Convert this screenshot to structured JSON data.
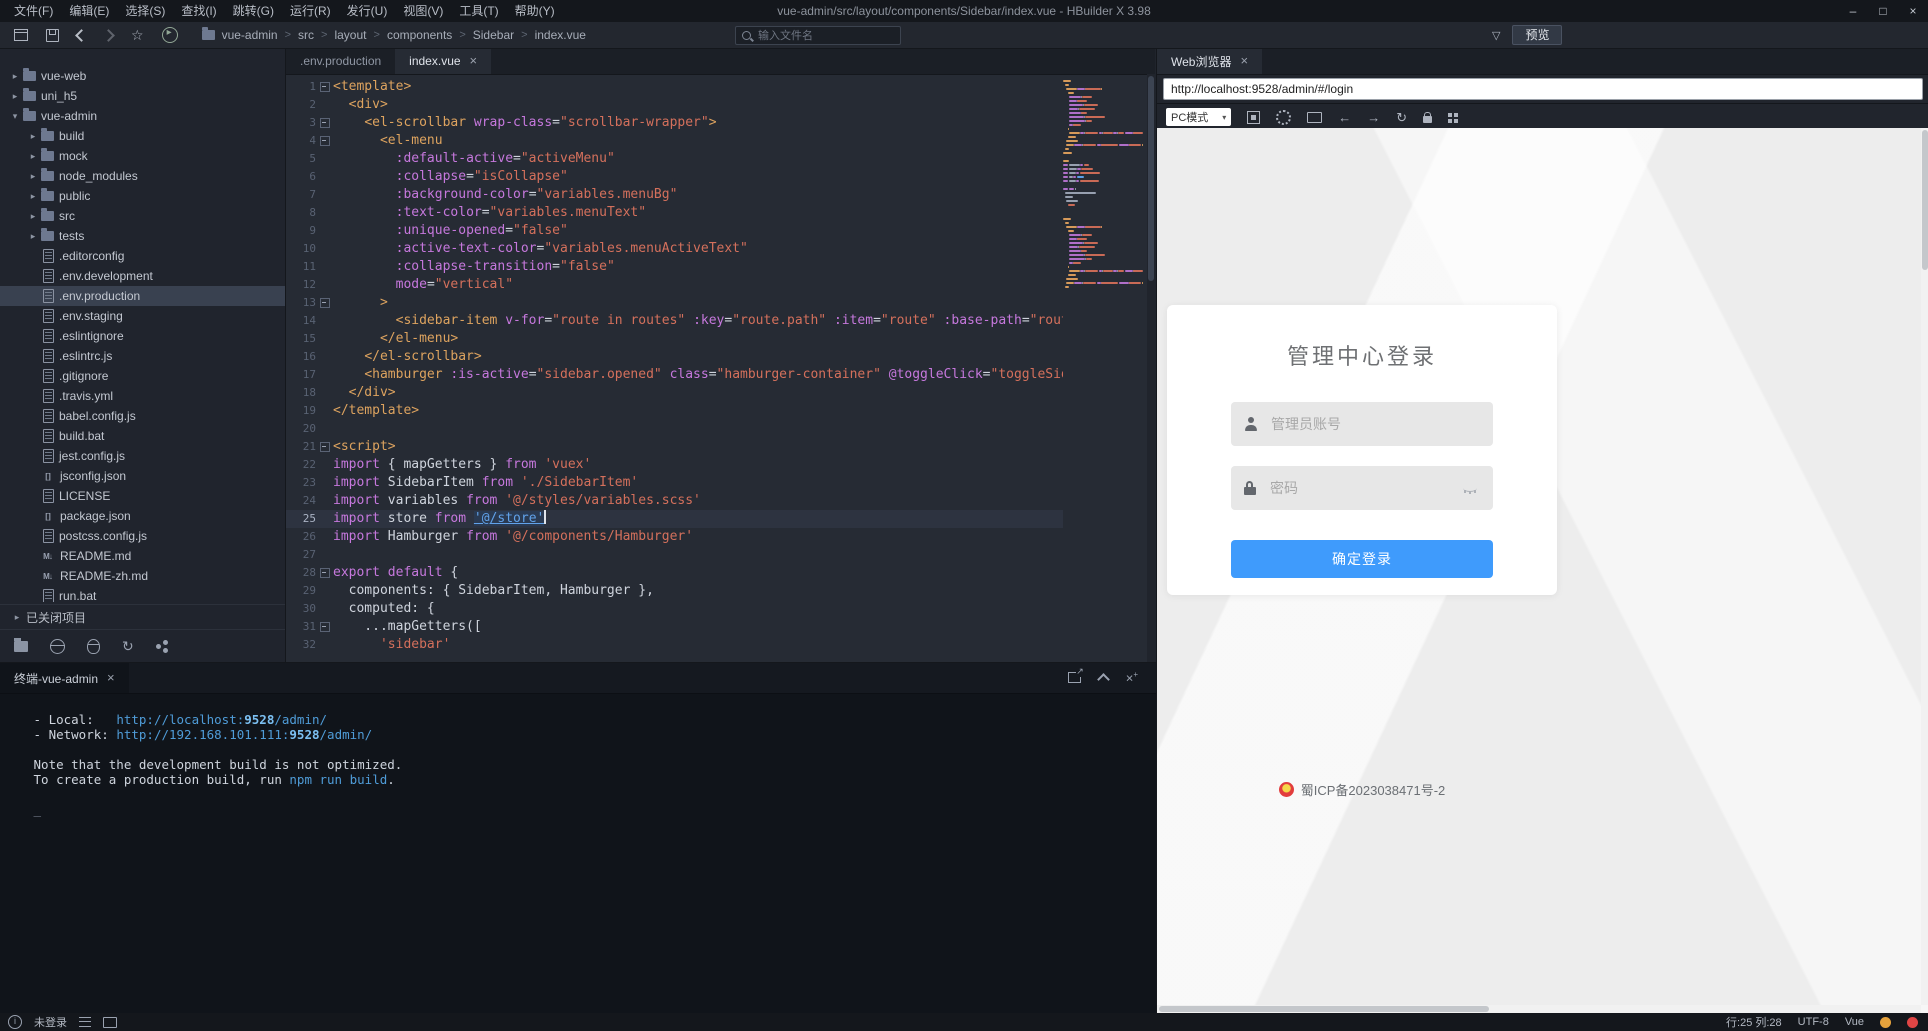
{
  "window": {
    "title": "vue-admin/src/layout/components/Sidebar/index.vue - HBuilder X 3.98",
    "menus": [
      "文件(F)",
      "编辑(E)",
      "选择(S)",
      "查找(I)",
      "跳转(G)",
      "运行(R)",
      "发行(U)",
      "视图(V)",
      "工具(T)",
      "帮助(Y)"
    ]
  },
  "icons": {
    "minimize": "–",
    "maximize": "□",
    "close": "×",
    "tab_close": "×",
    "chevron_right": "▸",
    "chevron_down": "▾",
    "breadcrumb_sep": ">",
    "dropdown": "▾",
    "back_arrow": "←",
    "forward_arrow": "→",
    "refresh": "↻",
    "external": "↗",
    "close_small": "×"
  },
  "toolbar": {
    "breadcrumb": [
      "vue-admin",
      "src",
      "layout",
      "components",
      "Sidebar",
      "index.vue"
    ],
    "search_placeholder": "输入文件名",
    "preview_label": "预览"
  },
  "file_tree": {
    "closed_projects_label": "已关闭项目",
    "items": [
      {
        "label": "vue-web",
        "level": 0,
        "kind": "project",
        "chev": "r"
      },
      {
        "label": "uni_h5",
        "level": 0,
        "kind": "project",
        "chev": "r"
      },
      {
        "label": "vue-admin",
        "level": 0,
        "kind": "project",
        "chev": "d"
      },
      {
        "label": "build",
        "level": 1,
        "kind": "folder",
        "chev": "r"
      },
      {
        "label": "mock",
        "level": 1,
        "kind": "folder",
        "chev": "r"
      },
      {
        "label": "node_modules",
        "level": 1,
        "kind": "folder",
        "chev": "r"
      },
      {
        "label": "public",
        "level": 1,
        "kind": "folder",
        "chev": "r"
      },
      {
        "label": "src",
        "level": 1,
        "kind": "folder",
        "chev": "r"
      },
      {
        "label": "tests",
        "level": 1,
        "kind": "folder",
        "chev": "r"
      },
      {
        "label": ".editorconfig",
        "level": 1,
        "kind": "file"
      },
      {
        "label": ".env.development",
        "level": 1,
        "kind": "file"
      },
      {
        "label": ".env.production",
        "level": 1,
        "kind": "file",
        "selected": true
      },
      {
        "label": ".env.staging",
        "level": 1,
        "kind": "file"
      },
      {
        "label": ".eslintignore",
        "level": 1,
        "kind": "file"
      },
      {
        "label": ".eslintrc.js",
        "level": 1,
        "kind": "file"
      },
      {
        "label": ".gitignore",
        "level": 1,
        "kind": "file"
      },
      {
        "label": ".travis.yml",
        "level": 1,
        "kind": "file"
      },
      {
        "label": "babel.config.js",
        "level": 1,
        "kind": "file"
      },
      {
        "label": "build.bat",
        "level": 1,
        "kind": "file"
      },
      {
        "label": "jest.config.js",
        "level": 1,
        "kind": "file"
      },
      {
        "label": "jsconfig.json",
        "level": 1,
        "kind": "json"
      },
      {
        "label": "LICENSE",
        "level": 1,
        "kind": "file"
      },
      {
        "label": "package.json",
        "level": 1,
        "kind": "json"
      },
      {
        "label": "postcss.config.js",
        "level": 1,
        "kind": "file"
      },
      {
        "label": "README.md",
        "level": 1,
        "kind": "md"
      },
      {
        "label": "README-zh.md",
        "level": 1,
        "kind": "md"
      },
      {
        "label": "run.bat",
        "level": 1,
        "kind": "file"
      }
    ]
  },
  "editor": {
    "tabs": [
      {
        "label": ".env.production",
        "active": false,
        "closable": false
      },
      {
        "label": "index.vue",
        "active": true,
        "closable": true
      }
    ],
    "current_line": 25,
    "fold_lines": [
      1,
      3,
      4,
      13,
      21,
      28,
      31
    ],
    "lines": [
      [
        [
          "<template>",
          "tag"
        ]
      ],
      [
        [
          "  ",
          "pl"
        ],
        [
          "<div>",
          "tag"
        ]
      ],
      [
        [
          "    ",
          "pl"
        ],
        [
          "<el-scrollbar ",
          "tag"
        ],
        [
          "wrap-class",
          "attr"
        ],
        [
          "=",
          "pl"
        ],
        [
          "\"scrollbar-wrapper\"",
          "str"
        ],
        [
          ">",
          "tag"
        ]
      ],
      [
        [
          "      ",
          "pl"
        ],
        [
          "<el-menu",
          "tag"
        ]
      ],
      [
        [
          "        ",
          "pl"
        ],
        [
          ":default-active",
          "attr"
        ],
        [
          "=",
          "pl"
        ],
        [
          "\"activeMenu\"",
          "str"
        ]
      ],
      [
        [
          "        ",
          "pl"
        ],
        [
          ":collapse",
          "attr"
        ],
        [
          "=",
          "pl"
        ],
        [
          "\"isCollapse\"",
          "str"
        ]
      ],
      [
        [
          "        ",
          "pl"
        ],
        [
          ":background-color",
          "attr"
        ],
        [
          "=",
          "pl"
        ],
        [
          "\"variables.menuBg\"",
          "str"
        ]
      ],
      [
        [
          "        ",
          "pl"
        ],
        [
          ":text-color",
          "attr"
        ],
        [
          "=",
          "pl"
        ],
        [
          "\"variables.menuText\"",
          "str"
        ]
      ],
      [
        [
          "        ",
          "pl"
        ],
        [
          ":unique-opened",
          "attr"
        ],
        [
          "=",
          "pl"
        ],
        [
          "\"false\"",
          "str"
        ]
      ],
      [
        [
          "        ",
          "pl"
        ],
        [
          ":active-text-color",
          "attr"
        ],
        [
          "=",
          "pl"
        ],
        [
          "\"variables.menuActiveText\"",
          "str"
        ]
      ],
      [
        [
          "        ",
          "pl"
        ],
        [
          ":collapse-transition",
          "attr"
        ],
        [
          "=",
          "pl"
        ],
        [
          "\"false\"",
          "str"
        ]
      ],
      [
        [
          "        ",
          "pl"
        ],
        [
          "mode",
          "attr"
        ],
        [
          "=",
          "pl"
        ],
        [
          "\"vertical\"",
          "str"
        ]
      ],
      [
        [
          "      ",
          "pl"
        ],
        [
          ">",
          "tag"
        ]
      ],
      [
        [
          "        ",
          "pl"
        ],
        [
          "<sidebar-item ",
          "tag"
        ],
        [
          "v-for",
          "attr"
        ],
        [
          "=",
          "pl"
        ],
        [
          "\"route in routes\"",
          "str"
        ],
        [
          " ",
          "pl"
        ],
        [
          ":key",
          "attr"
        ],
        [
          "=",
          "pl"
        ],
        [
          "\"route.path\"",
          "str"
        ],
        [
          " ",
          "pl"
        ],
        [
          ":item",
          "attr"
        ],
        [
          "=",
          "pl"
        ],
        [
          "\"route\"",
          "str"
        ],
        [
          " ",
          "pl"
        ],
        [
          ":base-path",
          "attr"
        ],
        [
          "=",
          "pl"
        ],
        [
          "\"route.path\"",
          "str"
        ]
      ],
      [
        [
          "      ",
          "pl"
        ],
        [
          "</el-menu>",
          "tag"
        ]
      ],
      [
        [
          "    ",
          "pl"
        ],
        [
          "</el-scrollbar>",
          "tag"
        ]
      ],
      [
        [
          "    ",
          "pl"
        ],
        [
          "<hamburger ",
          "tag"
        ],
        [
          ":is-active",
          "attr"
        ],
        [
          "=",
          "pl"
        ],
        [
          "\"sidebar.opened\"",
          "str"
        ],
        [
          " ",
          "pl"
        ],
        [
          "class",
          "attr"
        ],
        [
          "=",
          "pl"
        ],
        [
          "\"hamburger-container\"",
          "str"
        ],
        [
          " ",
          "pl"
        ],
        [
          "@toggleClick",
          "attr"
        ],
        [
          "=",
          "pl"
        ],
        [
          "\"toggleSideBar\"",
          "str"
        ],
        [
          " /",
          "tag"
        ]
      ],
      [
        [
          "  ",
          "pl"
        ],
        [
          "</div>",
          "tag"
        ]
      ],
      [
        [
          "</template>",
          "tag"
        ]
      ],
      [],
      [
        [
          "<script>",
          "tag"
        ]
      ],
      [
        [
          "import",
          "kw"
        ],
        [
          " { mapGetters } ",
          "pl"
        ],
        [
          "from",
          "kw"
        ],
        [
          " ",
          "pl"
        ],
        [
          "'vuex'",
          "str"
        ]
      ],
      [
        [
          "import",
          "kw"
        ],
        [
          " SidebarItem ",
          "pl"
        ],
        [
          "from",
          "kw"
        ],
        [
          " ",
          "pl"
        ],
        [
          "'./SidebarItem'",
          "str"
        ]
      ],
      [
        [
          "import",
          "kw"
        ],
        [
          " variables ",
          "pl"
        ],
        [
          "from",
          "kw"
        ],
        [
          " ",
          "pl"
        ],
        [
          "'@/styles/variables.scss'",
          "str"
        ]
      ],
      [
        [
          "import",
          "kw"
        ],
        [
          " store ",
          "pl"
        ],
        [
          "from",
          "kw"
        ],
        [
          " ",
          "pl"
        ],
        [
          "'@/store'",
          "lnk"
        ],
        [
          "",
          "caret"
        ]
      ],
      [
        [
          "import",
          "kw"
        ],
        [
          " Hamburger ",
          "pl"
        ],
        [
          "from",
          "kw"
        ],
        [
          " ",
          "pl"
        ],
        [
          "'@/components/Hamburger'",
          "str"
        ]
      ],
      [],
      [
        [
          "export",
          "kw"
        ],
        [
          " ",
          "pl"
        ],
        [
          "default",
          "kw"
        ],
        [
          " {",
          "pl"
        ]
      ],
      [
        [
          "  components: { SidebarItem, Hamburger },",
          "pl"
        ]
      ],
      [
        [
          "  computed: {",
          "pl"
        ]
      ],
      [
        [
          "    ...mapGetters([",
          "pl"
        ]
      ],
      [
        [
          "      ",
          "pl"
        ],
        [
          "'sidebar'",
          "str"
        ]
      ]
    ]
  },
  "terminal": {
    "tab_label": "终端-vue-admin",
    "lines": [
      [
        [
          " - Local:   ",
          "pl"
        ],
        [
          "http://localhost:",
          "lk"
        ],
        [
          "9528",
          "lkb"
        ],
        [
          "/admin/",
          "lk"
        ]
      ],
      [
        [
          " - Network: ",
          "pl"
        ],
        [
          "http://192.168.101.111:",
          "lk"
        ],
        [
          "9528",
          "lkb"
        ],
        [
          "/admin/",
          "lk"
        ]
      ],
      [],
      [
        [
          " Note that the development build is not optimized.",
          "pl"
        ]
      ],
      [
        [
          " To create a production build, run ",
          "pl"
        ],
        [
          "npm run build",
          "lk"
        ],
        [
          ".",
          "pl"
        ]
      ],
      [],
      [
        [
          " _",
          "dim"
        ]
      ]
    ]
  },
  "browser": {
    "tab_label": "Web浏览器",
    "url": "http://localhost:9528/admin/#/login",
    "mode_label": "PC模式",
    "login": {
      "title": "管理中心登录",
      "username_placeholder": "管理员账号",
      "password_placeholder": "密码",
      "submit_label": "确定登录",
      "icp": "蜀ICP备2023038471号-2"
    }
  },
  "statusbar": {
    "user": "未登录",
    "cursor": "行:25 列:28",
    "encoding": "UTF-8",
    "language": "Vue"
  }
}
